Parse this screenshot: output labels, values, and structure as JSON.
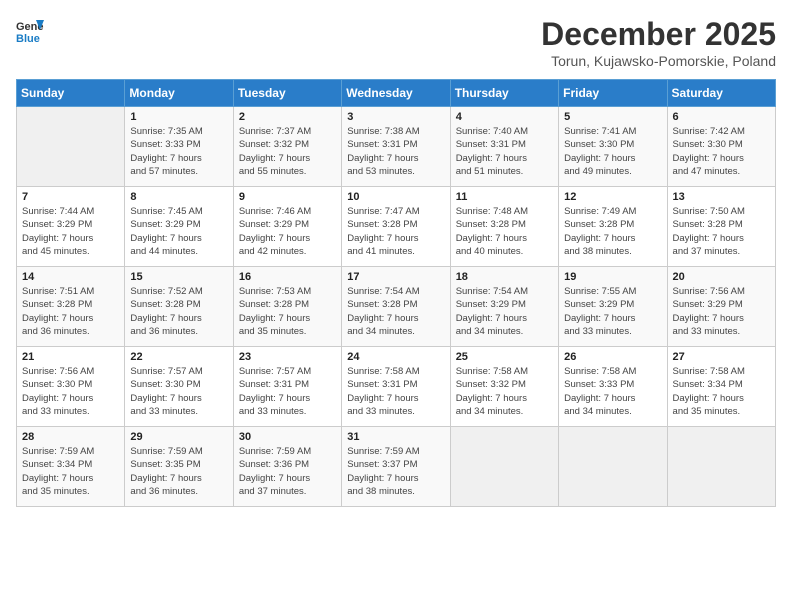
{
  "header": {
    "logo_general": "General",
    "logo_blue": "Blue",
    "month_year": "December 2025",
    "location": "Torun, Kujawsko-Pomorskie, Poland"
  },
  "weekdays": [
    "Sunday",
    "Monday",
    "Tuesday",
    "Wednesday",
    "Thursday",
    "Friday",
    "Saturday"
  ],
  "weeks": [
    [
      {
        "day": "",
        "info": ""
      },
      {
        "day": "1",
        "info": "Sunrise: 7:35 AM\nSunset: 3:33 PM\nDaylight: 7 hours\nand 57 minutes."
      },
      {
        "day": "2",
        "info": "Sunrise: 7:37 AM\nSunset: 3:32 PM\nDaylight: 7 hours\nand 55 minutes."
      },
      {
        "day": "3",
        "info": "Sunrise: 7:38 AM\nSunset: 3:31 PM\nDaylight: 7 hours\nand 53 minutes."
      },
      {
        "day": "4",
        "info": "Sunrise: 7:40 AM\nSunset: 3:31 PM\nDaylight: 7 hours\nand 51 minutes."
      },
      {
        "day": "5",
        "info": "Sunrise: 7:41 AM\nSunset: 3:30 PM\nDaylight: 7 hours\nand 49 minutes."
      },
      {
        "day": "6",
        "info": "Sunrise: 7:42 AM\nSunset: 3:30 PM\nDaylight: 7 hours\nand 47 minutes."
      }
    ],
    [
      {
        "day": "7",
        "info": "Sunrise: 7:44 AM\nSunset: 3:29 PM\nDaylight: 7 hours\nand 45 minutes."
      },
      {
        "day": "8",
        "info": "Sunrise: 7:45 AM\nSunset: 3:29 PM\nDaylight: 7 hours\nand 44 minutes."
      },
      {
        "day": "9",
        "info": "Sunrise: 7:46 AM\nSunset: 3:29 PM\nDaylight: 7 hours\nand 42 minutes."
      },
      {
        "day": "10",
        "info": "Sunrise: 7:47 AM\nSunset: 3:28 PM\nDaylight: 7 hours\nand 41 minutes."
      },
      {
        "day": "11",
        "info": "Sunrise: 7:48 AM\nSunset: 3:28 PM\nDaylight: 7 hours\nand 40 minutes."
      },
      {
        "day": "12",
        "info": "Sunrise: 7:49 AM\nSunset: 3:28 PM\nDaylight: 7 hours\nand 38 minutes."
      },
      {
        "day": "13",
        "info": "Sunrise: 7:50 AM\nSunset: 3:28 PM\nDaylight: 7 hours\nand 37 minutes."
      }
    ],
    [
      {
        "day": "14",
        "info": "Sunrise: 7:51 AM\nSunset: 3:28 PM\nDaylight: 7 hours\nand 36 minutes."
      },
      {
        "day": "15",
        "info": "Sunrise: 7:52 AM\nSunset: 3:28 PM\nDaylight: 7 hours\nand 36 minutes."
      },
      {
        "day": "16",
        "info": "Sunrise: 7:53 AM\nSunset: 3:28 PM\nDaylight: 7 hours\nand 35 minutes."
      },
      {
        "day": "17",
        "info": "Sunrise: 7:54 AM\nSunset: 3:28 PM\nDaylight: 7 hours\nand 34 minutes."
      },
      {
        "day": "18",
        "info": "Sunrise: 7:54 AM\nSunset: 3:29 PM\nDaylight: 7 hours\nand 34 minutes."
      },
      {
        "day": "19",
        "info": "Sunrise: 7:55 AM\nSunset: 3:29 PM\nDaylight: 7 hours\nand 33 minutes."
      },
      {
        "day": "20",
        "info": "Sunrise: 7:56 AM\nSunset: 3:29 PM\nDaylight: 7 hours\nand 33 minutes."
      }
    ],
    [
      {
        "day": "21",
        "info": "Sunrise: 7:56 AM\nSunset: 3:30 PM\nDaylight: 7 hours\nand 33 minutes."
      },
      {
        "day": "22",
        "info": "Sunrise: 7:57 AM\nSunset: 3:30 PM\nDaylight: 7 hours\nand 33 minutes."
      },
      {
        "day": "23",
        "info": "Sunrise: 7:57 AM\nSunset: 3:31 PM\nDaylight: 7 hours\nand 33 minutes."
      },
      {
        "day": "24",
        "info": "Sunrise: 7:58 AM\nSunset: 3:31 PM\nDaylight: 7 hours\nand 33 minutes."
      },
      {
        "day": "25",
        "info": "Sunrise: 7:58 AM\nSunset: 3:32 PM\nDaylight: 7 hours\nand 34 minutes."
      },
      {
        "day": "26",
        "info": "Sunrise: 7:58 AM\nSunset: 3:33 PM\nDaylight: 7 hours\nand 34 minutes."
      },
      {
        "day": "27",
        "info": "Sunrise: 7:58 AM\nSunset: 3:34 PM\nDaylight: 7 hours\nand 35 minutes."
      }
    ],
    [
      {
        "day": "28",
        "info": "Sunrise: 7:59 AM\nSunset: 3:34 PM\nDaylight: 7 hours\nand 35 minutes."
      },
      {
        "day": "29",
        "info": "Sunrise: 7:59 AM\nSunset: 3:35 PM\nDaylight: 7 hours\nand 36 minutes."
      },
      {
        "day": "30",
        "info": "Sunrise: 7:59 AM\nSunset: 3:36 PM\nDaylight: 7 hours\nand 37 minutes."
      },
      {
        "day": "31",
        "info": "Sunrise: 7:59 AM\nSunset: 3:37 PM\nDaylight: 7 hours\nand 38 minutes."
      },
      {
        "day": "",
        "info": ""
      },
      {
        "day": "",
        "info": ""
      },
      {
        "day": "",
        "info": ""
      }
    ]
  ]
}
